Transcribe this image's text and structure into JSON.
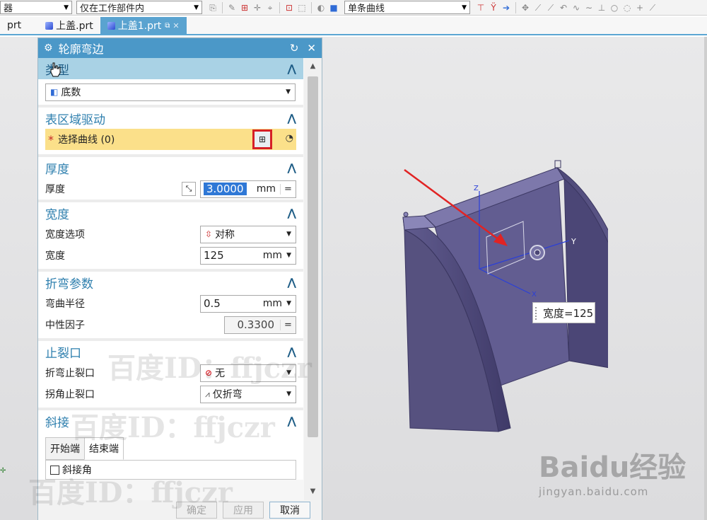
{
  "toolbar": {
    "filter_combo": "器",
    "scope_combo": "仅在工作部件内",
    "curve_rule_combo": "单条曲线"
  },
  "tabs": [
    {
      "label": "prt"
    },
    {
      "label": "上盖.prt"
    },
    {
      "label": "上盖1.prt"
    }
  ],
  "dialog": {
    "title": "轮廓弯边",
    "type": {
      "heading": "类型",
      "value": "底数"
    },
    "surface": {
      "heading": "表区域驱动",
      "select_label": "选择曲线 (0)"
    },
    "thickness": {
      "heading": "厚度",
      "label": "厚度",
      "value": "3.0000",
      "unit": "mm",
      "eq": "="
    },
    "width": {
      "heading": "宽度",
      "option_label": "宽度选项",
      "option_value": "对称",
      "label": "宽度",
      "value": "125",
      "unit": "mm"
    },
    "bend": {
      "heading": "折弯参数",
      "radius_label": "弯曲半径",
      "radius_value": "0.5",
      "radius_unit": "mm",
      "kfactor_label": "中性因子",
      "kfactor_value": "0.3300",
      "eq": "="
    },
    "relief": {
      "heading": "止裂口",
      "bend_label": "折弯止裂口",
      "bend_value": "无",
      "corner_label": "拐角止裂口",
      "corner_value": "仅折弯"
    },
    "miter": {
      "heading": "斜接",
      "tab_start": "开始端",
      "tab_end": "结束端",
      "checkbox_label": "斜接角"
    },
    "buttons": {
      "ok": "确定",
      "apply": "应用",
      "cancel": "取消"
    }
  },
  "viewport": {
    "dimension_label": "宽度=125",
    "axis_x": "X",
    "axis_y": "Y",
    "axis_z": "Z"
  },
  "watermark": {
    "text": "百度ID：ffjczr"
  },
  "branding": {
    "logo": "Baidu经验",
    "url": "jingyan.baidu.com"
  },
  "colors": {
    "accent": "#4b98c8",
    "section_header": "#a9d2e5",
    "selection": "#fbe08a",
    "highlight_red": "#d61f26",
    "model": "#5b5688"
  }
}
